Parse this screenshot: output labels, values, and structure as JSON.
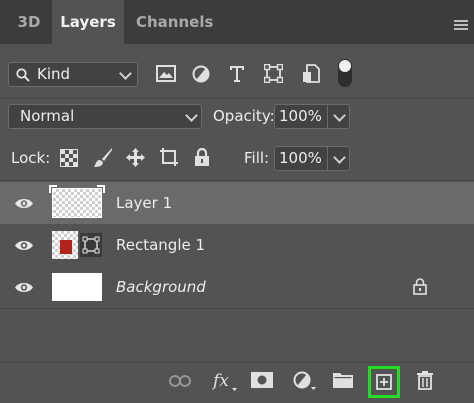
{
  "tabs": [
    {
      "label": "3D",
      "active": false
    },
    {
      "label": "Layers",
      "active": true
    },
    {
      "label": "Channels",
      "active": false
    }
  ],
  "filter": {
    "kind_label": "Kind",
    "icons": [
      "image-filter-icon",
      "adjustment-filter-icon",
      "type-filter-icon",
      "shape-filter-icon",
      "smart-object-filter-icon",
      "filter-toggle-icon"
    ]
  },
  "blend": {
    "mode": "Normal",
    "opacity_label": "Opacity:",
    "opacity_value": "100%"
  },
  "lock": {
    "label": "Lock:",
    "fill_label": "Fill:",
    "fill_value": "100%"
  },
  "layers": [
    {
      "name": "Layer 1",
      "selected": true,
      "italic": false,
      "locked": false
    },
    {
      "name": "Rectangle 1",
      "selected": false,
      "italic": false,
      "locked": false
    },
    {
      "name": "Background",
      "selected": false,
      "italic": true,
      "locked": true
    }
  ],
  "colors": {
    "panel": "#535353",
    "tabbar": "#3c3c3c",
    "selected_row": "#6a6a6a",
    "highlight": "#22dd22",
    "rect_red": "#b3241c"
  },
  "bottom_icons": [
    "link-icon",
    "fx-icon",
    "mask-icon",
    "adjustment-icon",
    "folder-icon",
    "new-layer-icon",
    "trash-icon"
  ]
}
